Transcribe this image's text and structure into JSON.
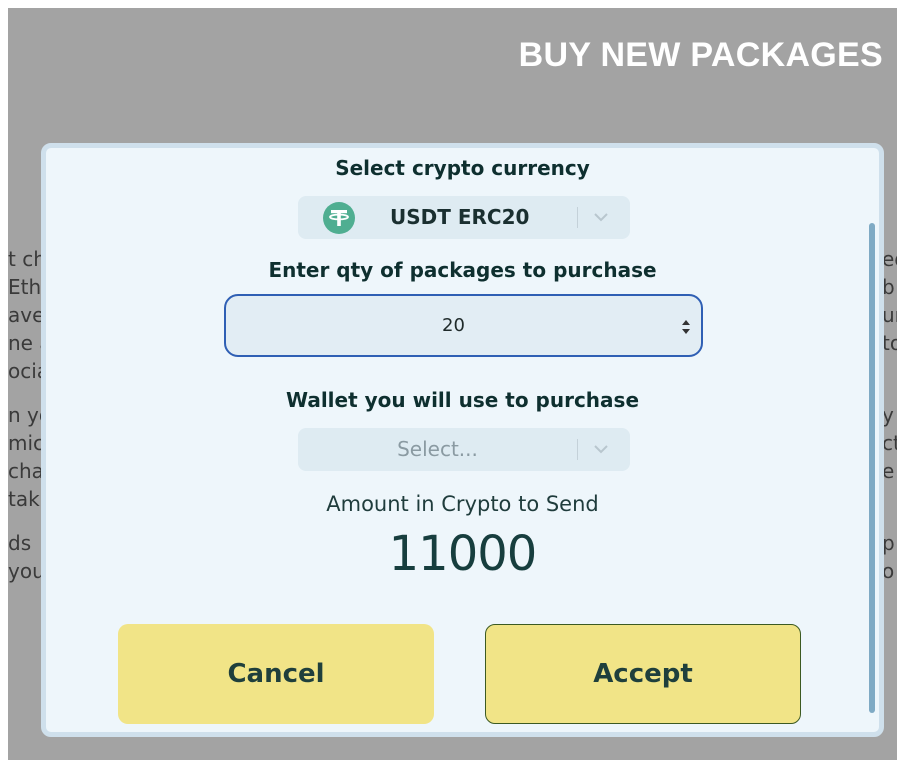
{
  "page": {
    "title": "BUY NEW PACKAGES"
  },
  "background": {
    "left_fragments": [
      "t ch",
      "Eth",
      "ave",
      "ne a",
      "ocia",
      "n yo",
      "mic",
      "cha",
      "tak",
      "ds",
      "you"
    ],
    "right_fragments": [
      "ed",
      "b",
      "un",
      "to",
      "y",
      "ct",
      "e",
      "p",
      "o"
    ]
  },
  "modal": {
    "currency_label": "Select crypto currency",
    "currency_selected": "USDT ERC20",
    "currency_icon": "tether-icon",
    "qty_label": "Enter qty of packages to purchase",
    "qty_value": "20",
    "wallet_label": "Wallet you will use to purchase",
    "wallet_placeholder": "Select...",
    "amount_label": "Amount in Crypto to Send",
    "amount_value": "11000",
    "cancel_label": "Cancel",
    "accept_label": "Accept"
  },
  "colors": {
    "backdrop": "#a3a3a3",
    "modal_bg": "#eef6fb",
    "button": "#f1e487",
    "input_focus_border": "#2f5fb4",
    "tether_green": "#4fae91"
  }
}
